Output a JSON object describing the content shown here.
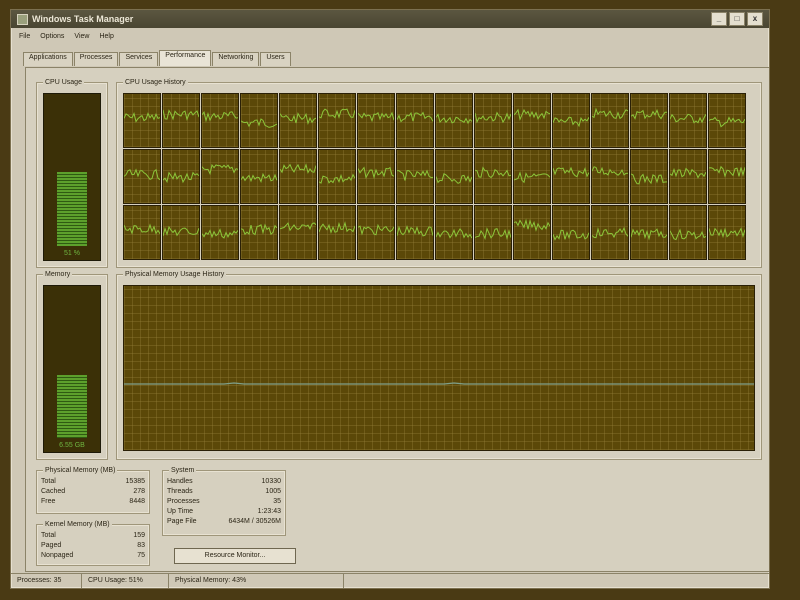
{
  "window": {
    "title": "Windows Task Manager",
    "controls": [
      "_",
      "□",
      "x"
    ]
  },
  "menu": [
    "File",
    "Options",
    "View",
    "Help"
  ],
  "tabs": [
    {
      "label": "Applications",
      "active": false
    },
    {
      "label": "Processes",
      "active": false
    },
    {
      "label": "Services",
      "active": false
    },
    {
      "label": "Performance",
      "active": true
    },
    {
      "label": "Networking",
      "active": false
    },
    {
      "label": "Users",
      "active": false
    }
  ],
  "cpu_usage": {
    "title": "CPU Usage",
    "value_label": "51 %",
    "level": 0.51
  },
  "cpu_history": {
    "title": "CPU Usage History"
  },
  "memory": {
    "title": "Memory",
    "value_label": "6.55 GB",
    "level": 0.43
  },
  "memory_history": {
    "title": "Physical Memory Usage History"
  },
  "physical_memory": {
    "title": "Physical Memory (MB)",
    "rows": [
      {
        "label": "Total",
        "value": "15385"
      },
      {
        "label": "Cached",
        "value": "278"
      },
      {
        "label": "Free",
        "value": "8448"
      }
    ]
  },
  "kernel_memory": {
    "title": "Kernel Memory (MB)",
    "rows": [
      {
        "label": "Total",
        "value": "159"
      },
      {
        "label": "Paged",
        "value": "83"
      },
      {
        "label": "Nonpaged",
        "value": "75"
      }
    ]
  },
  "system": {
    "title": "System",
    "rows": [
      {
        "label": "Handles",
        "value": "10330"
      },
      {
        "label": "Threads",
        "value": "1005"
      },
      {
        "label": "Processes",
        "value": "35"
      },
      {
        "label": "Up Time",
        "value": "1:23:43"
      },
      {
        "label": "Page File",
        "value": "6434M / 30526M"
      }
    ]
  },
  "resource_monitor_label": "Resource Monitor...",
  "status": {
    "processes": "Processes: 35",
    "cpu": "CPU Usage: 51%",
    "memory": "Physical Memory: 43%"
  },
  "colors": {
    "graph_bg": "#5b4808",
    "graph_line": "#8cc63a",
    "meter_fill": "#5da02c"
  }
}
